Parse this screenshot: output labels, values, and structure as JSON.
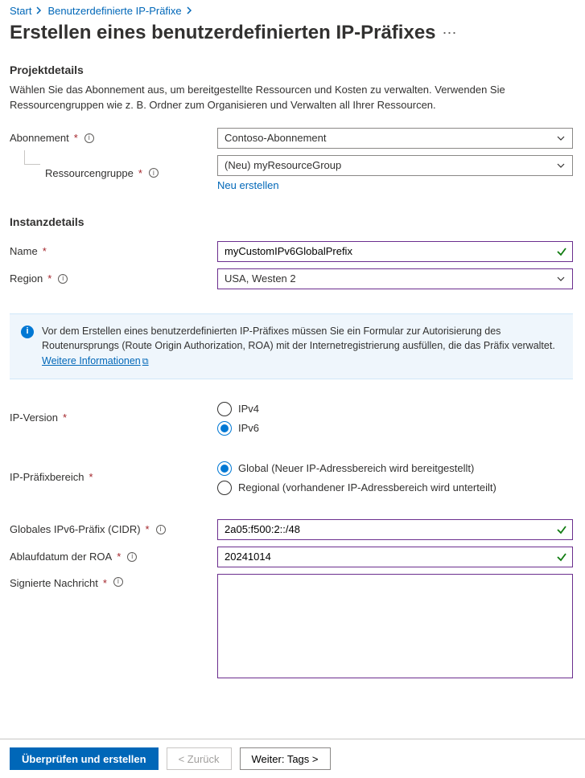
{
  "breadcrumb": {
    "home": "Start",
    "items": [
      "Benutzerdefinierte IP-Präfixe"
    ]
  },
  "title": "Erstellen eines benutzerdefinierten IP-Präfixes",
  "sections": {
    "project": {
      "heading": "Projektdetails",
      "description": "Wählen Sie das Abonnement aus, um bereitgestellte Ressourcen und Kosten zu verwalten. Verwenden Sie Ressourcengruppen wie z. B. Ordner zum Organisieren und Verwalten all Ihrer Ressourcen."
    },
    "instance": {
      "heading": "Instanzdetails"
    }
  },
  "labels": {
    "subscription": "Abonnement",
    "resourceGroup": "Ressourcengruppe",
    "createNew": "Neu erstellen",
    "name": "Name",
    "region": "Region",
    "ipVersion": "IP-Version",
    "ipPrefixRange": "IP-Präfixbereich",
    "globalIpv6Prefix": "Globales IPv6-Präfix (CIDR)",
    "roaExpiry": "Ablaufdatum der ROA",
    "signedMessage": "Signierte Nachricht"
  },
  "values": {
    "subscription": "Contoso-Abonnement",
    "resourceGroup": "(Neu) myResourceGroup",
    "name": "myCustomIPv6GlobalPrefix",
    "region": "USA, Westen 2",
    "globalIpv6Prefix": "2a05:f500:2::/48",
    "roaExpiry": "20241014",
    "signedMessage": ""
  },
  "radios": {
    "ipVersion": {
      "selected": "IPv6",
      "options": [
        "IPv4",
        "IPv6"
      ]
    },
    "ipPrefixRange": {
      "selected": "Global",
      "options": [
        {
          "value": "Global",
          "label": "Global (Neuer IP-Adressbereich wird bereitgestellt)"
        },
        {
          "value": "Regional",
          "label": "Regional (vorhandener IP-Adressbereich wird unterteilt)"
        }
      ]
    }
  },
  "infoBox": {
    "text": "Vor dem Erstellen eines benutzerdefinierten IP-Präfixes müssen Sie ein Formular zur Autorisierung des Routenursprungs (Route Origin Authorization, ROA) mit der Internetregistrierung ausfüllen, die das Präfix verwaltet. ",
    "linkText": "Weitere Informationen"
  },
  "footer": {
    "review": "Überprüfen und erstellen",
    "back": "<  Zurück",
    "next": "Weiter: Tags >"
  }
}
